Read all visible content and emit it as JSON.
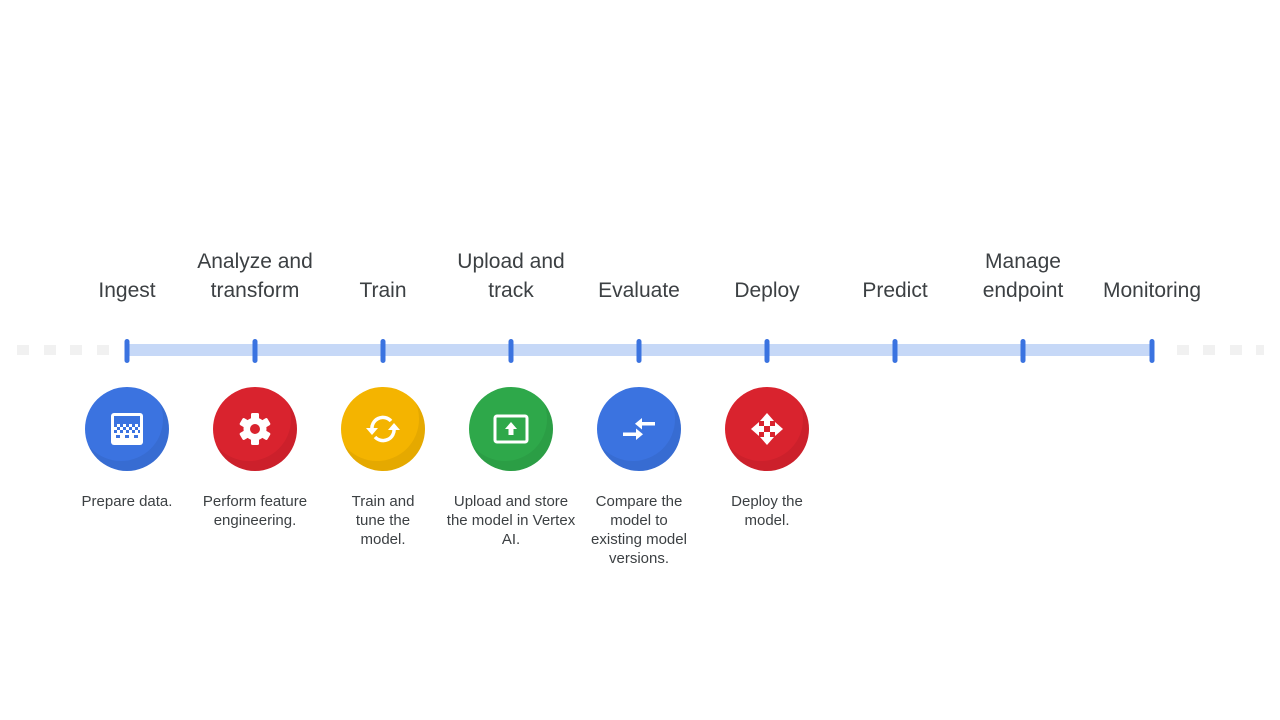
{
  "stages": [
    {
      "label": "Ingest",
      "description": "Prepare data.",
      "icon": "data-table-icon",
      "color": "#3b73e0"
    },
    {
      "label": "Analyze and transform",
      "description": "Perform feature engineering.",
      "icon": "gear-icon",
      "color": "#d9232e"
    },
    {
      "label": "Train",
      "description": "Train and tune the model.",
      "icon": "sync-icon",
      "color": "#f4b400"
    },
    {
      "label": "Upload and track",
      "description": "Upload and store the model in Vertex AI.",
      "icon": "upload-icon",
      "color": "#2ea84a"
    },
    {
      "label": "Evaluate",
      "description": "Compare the model to existing model versions.",
      "icon": "compare-arrows-icon",
      "color": "#3b73e0"
    },
    {
      "label": "Deploy",
      "description": "Deploy the model.",
      "icon": "move-arrows-icon",
      "color": "#d9232e"
    },
    {
      "label": "Predict",
      "description": "",
      "icon": "",
      "color": ""
    },
    {
      "label": "Manage endpoint",
      "description": "",
      "icon": "",
      "color": ""
    },
    {
      "label": "Monitoring",
      "description": "",
      "icon": "",
      "color": ""
    }
  ],
  "colors": {
    "timeline": "#c6d8f7",
    "tick": "#3b73e0",
    "text": "#3c4043"
  }
}
